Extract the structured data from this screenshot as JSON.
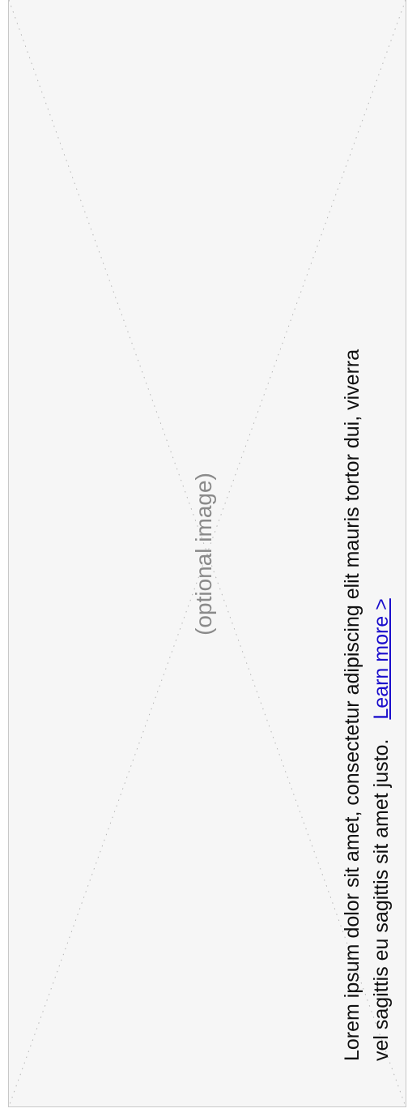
{
  "placeholder": {
    "label": "(optional image)"
  },
  "card": {
    "body_line_1": "Lorem ipsum dolor sit amet, consectetur adipiscing elit  mauris tortor dui, viverra",
    "body_line_2": "vel sagittis eu sagittis sit amet justo.",
    "link_text": "Learn more >"
  },
  "colors": {
    "panel_background": "#f6f6f6",
    "panel_border": "#c8c8c8",
    "placeholder_text": "#8a8a8a",
    "body_text": "#111111",
    "link": "#1a0dcc"
  }
}
